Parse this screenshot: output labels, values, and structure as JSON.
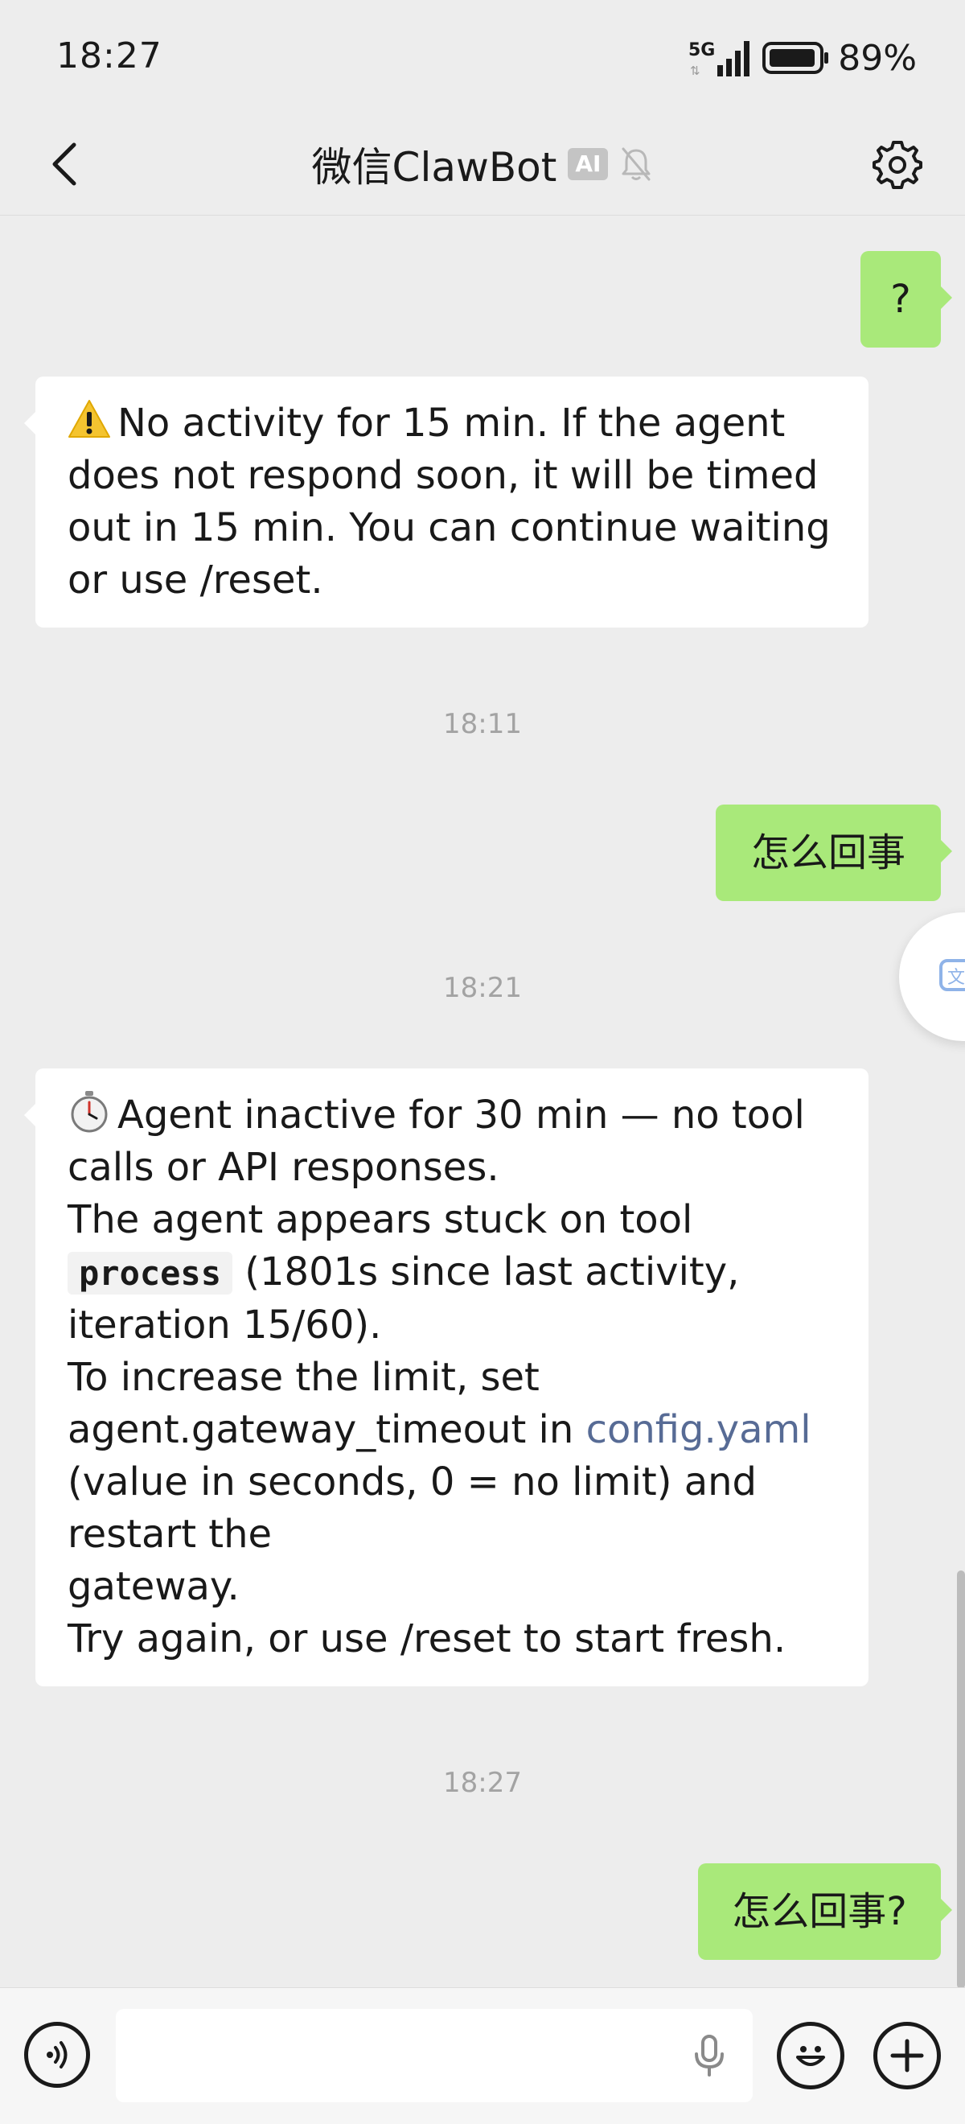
{
  "status_bar": {
    "time": "18:27",
    "network": "5G",
    "battery": "89%"
  },
  "header": {
    "title": "微信ClawBot",
    "ai_badge": "AI"
  },
  "messages": {
    "m1_text": "?",
    "m2_lines": [
      "No activity for 15 min. If the agent",
      "does not respond soon, it will be timed",
      "out in 15 min. You can continue waiting",
      "or use /reset."
    ],
    "ts1": "18:11",
    "m3_text": "怎么回事",
    "ts2": "18:21",
    "m4": {
      "line1": "Agent inactive for 30 min — no tool",
      "line2": "calls or API responses.",
      "line3": "The agent appears stuck on tool",
      "code": "process",
      "line4_rest": "(1801s since last activity,",
      "line5": "iteration 15/60).",
      "line6": "To increase the limit, set",
      "line7_prefix": "agent.gateway_timeout in",
      "line7_link": "config.yaml",
      "line8": "(value in seconds, 0 = no limit) and",
      "line9": "restart the",
      "line10": "gateway.",
      "line11": "Try again, or use /reset to start fresh."
    },
    "ts3": "18:27",
    "m5_text": "怎么回事?"
  },
  "input": {
    "placeholder": ""
  },
  "icons": {
    "back": "chevron-left-icon",
    "settings": "gear-icon",
    "mute": "bell-off-icon",
    "warning_emoji": "warning-icon",
    "stopwatch_emoji": "stopwatch-icon",
    "voice": "voice-icon",
    "mic": "microphone-icon",
    "emoji": "emoji-icon",
    "plus": "plus-icon",
    "translate": "translate-icon"
  },
  "colors": {
    "my_bubble": "#a9e97a",
    "bot_bubble": "#ffffff",
    "background": "#ededed",
    "link": "#576b95"
  }
}
